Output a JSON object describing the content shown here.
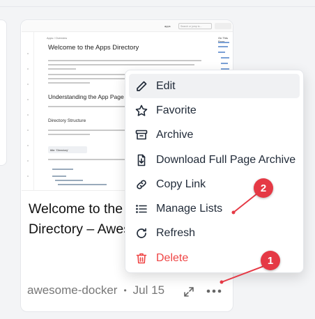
{
  "card": {
    "thumbnail": {
      "breadcrumb": "Apps / Overview",
      "heading": "Welcome to the Apps Directory",
      "subheading": "Understanding the App Page Structure",
      "section": "Directory Structure",
      "code_label": "title: 'Directory'",
      "toolbar_apps": "apps",
      "search_placeholder": "Search or jump to...",
      "side_title": "On This Page"
    },
    "title_line1": "Welcome to the Apps",
    "title_line2": "Directory – Awesome",
    "source": "awesome-docker",
    "date": "Jul 15"
  },
  "menu": {
    "items": [
      {
        "label": "Edit",
        "icon": "pencil-icon"
      },
      {
        "label": "Favorite",
        "icon": "star-icon"
      },
      {
        "label": "Archive",
        "icon": "archive-box-icon"
      },
      {
        "label": "Download Full Page Archive",
        "icon": "download-file-icon"
      },
      {
        "label": "Copy Link",
        "icon": "link-icon"
      },
      {
        "label": "Manage Lists",
        "icon": "list-icon"
      },
      {
        "label": "Refresh",
        "icon": "refresh-icon"
      },
      {
        "label": "Delete",
        "icon": "trash-icon"
      }
    ]
  },
  "annotations": {
    "badge1": "1",
    "badge2": "2"
  },
  "colors": {
    "accent_red": "#e53945",
    "delete_red": "#ef4444",
    "hover_bg": "#f0f1f3"
  }
}
